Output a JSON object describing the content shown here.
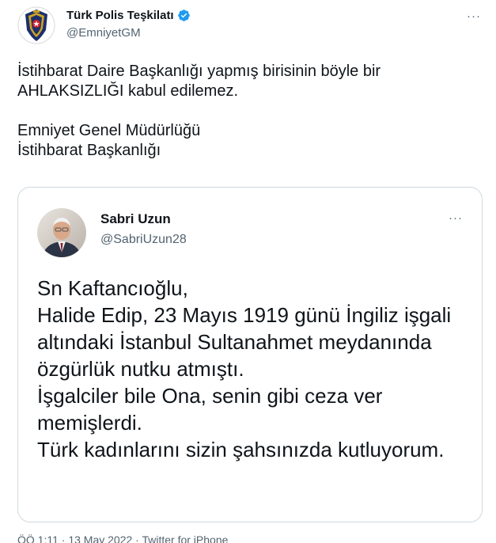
{
  "tweet": {
    "author_name": "Türk Polis Teşkilatı",
    "author_handle": "@EmniyetGM",
    "more_icon": "more-horizontal-icon",
    "text": "İstihbarat Daire Başkanlığı yapmış birisinin böyle bir\nAHLAKSIZLIĞI kabul edilemez.\n\nEmniyet Genel Müdürlüğü\nİstihbarat Başkanlığı",
    "meta": "ÖÖ 1:11 · 13 May 2022 · Twitter for iPhone"
  },
  "quoted_tweet": {
    "author_name": "Sabri Uzun",
    "author_handle": "@SabriUzun28",
    "more_icon": "more-horizontal-icon",
    "text": "Sn Kaftancıoğlu,\nHalide Edip, 23 Mayıs 1919 günü İngiliz işgali altındaki İstanbul Sultanahmet meydanında özgürlük nutku atmıştı.\nİşgalciler bile Ona, senin gibi ceza ver memişlerdi.\nTürk kadınlarını sizin şahsınızda kutluyorum."
  },
  "colors": {
    "text": "#0f1419",
    "secondary": "#536471",
    "verified": "#1d9bf0",
    "border": "#cfd9de"
  }
}
